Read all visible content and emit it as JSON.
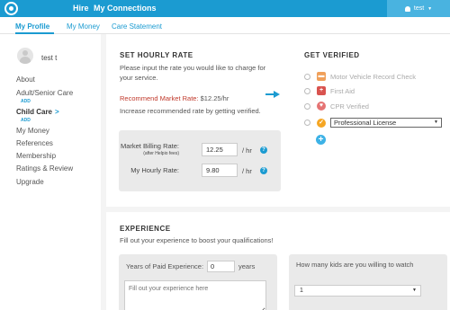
{
  "topbar": {
    "nav": [
      "Hire",
      "My Connections"
    ],
    "user_label": "test",
    "caret": "▼"
  },
  "subnav": {
    "tabs": [
      "My Profile",
      "My Money",
      "Care Statement"
    ]
  },
  "sidebar": {
    "username": "test t",
    "items": [
      "About",
      "Adult/Senior Care",
      "Child Care",
      "My Money",
      "References",
      "Membership",
      "Ratings & Review",
      "Upgrade"
    ],
    "add_label": "ADD",
    "active_arrow": ">"
  },
  "hourly_rate": {
    "title": "SET HOURLY RATE",
    "intro": "Please input the rate you would like to charge for your service.",
    "recommend_prefix": "Recommend Market Rate: ",
    "recommend_value": "$12.25/hr",
    "tip": "Increase recommended rate by getting verified.",
    "billing_label": "Market Billing Rate:",
    "billing_sub": "(after Helpio fees)",
    "billing_value": "12.25",
    "my_rate_label": "My Hourly Rate:",
    "my_rate_value": "9.80",
    "per_hr": "/ hr",
    "help": "?"
  },
  "verified": {
    "title": "GET VERIFIED",
    "items": [
      {
        "label": "Motor Vehicle Record Check",
        "icon": "car-icon",
        "color": "#f0a05a"
      },
      {
        "label": "First Aid",
        "icon": "first-aid-icon",
        "color": "#d9534f"
      },
      {
        "label": "CPR Verified",
        "icon": "heart-icon",
        "color": "#e57373"
      }
    ],
    "license_select": "Professional License",
    "license_icon_color": "#f5a623",
    "add": "+"
  },
  "experience": {
    "title": "EXPERIENCE",
    "intro": "Fill out your experience to boost your qualifications!",
    "years_label": "Years of Paid Experience:",
    "years_value": "0",
    "years_suffix": "years",
    "textarea_placeholder": "Fill out your experience here",
    "kids_question": "How many kids are you willing to watch",
    "kids_value": "1"
  },
  "colors": {
    "accent": "#1b9bd1",
    "recommend": "#c0392b"
  }
}
